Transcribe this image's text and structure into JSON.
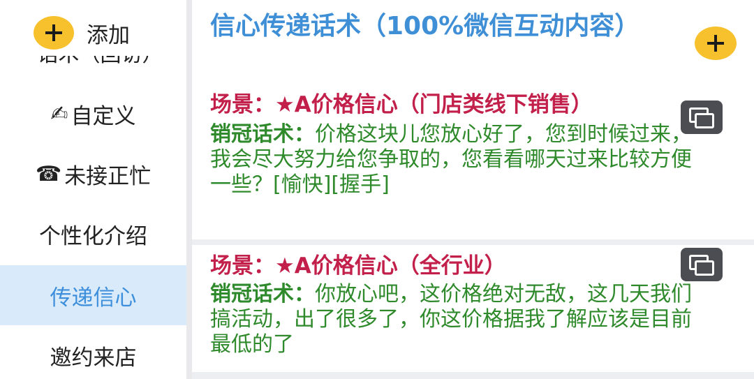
{
  "sidebar": {
    "add_label": "添加",
    "cut_item_label": "一  话术（回访）",
    "items": [
      {
        "icon": "✍",
        "label": "自定义",
        "active": false
      },
      {
        "icon": "☎",
        "label": "未接正忙",
        "active": false
      },
      {
        "icon": "",
        "label": "个性化介绍",
        "active": false
      },
      {
        "icon": "",
        "label": "传递信心",
        "active": true
      },
      {
        "icon": "",
        "label": "邀约来店",
        "active": false
      }
    ]
  },
  "main": {
    "title": "信心传递话术（100%微信互动内容）",
    "cards": [
      {
        "scene": "场景：★A价格信心（门店类线下销售）",
        "lead": "销冠话术：",
        "text": "价格这块儿您放心好了，您到时候过来，我会尽大努力给您争取的，您看看哪天过来比较方便一些？[愉快][握手]"
      },
      {
        "scene": "场景：★A价格信心（全行业）",
        "lead": "销冠话术：",
        "text": "你放心吧，这价格绝对无敌，这几天我们搞活动，出了很多了，你这价格据我了解应该是目前最低的了"
      }
    ]
  },
  "icons": {
    "add": "plus-icon",
    "copy": "copy-icon",
    "edit": "writing-hand-icon",
    "phone": "telephone-icon"
  },
  "colors": {
    "accent_blue": "#3f8fd6",
    "scene_red": "#c21f4a",
    "body_green": "#2f8a2c",
    "add_yellow": "#f7c12d",
    "active_bg": "#d9ebfb"
  }
}
